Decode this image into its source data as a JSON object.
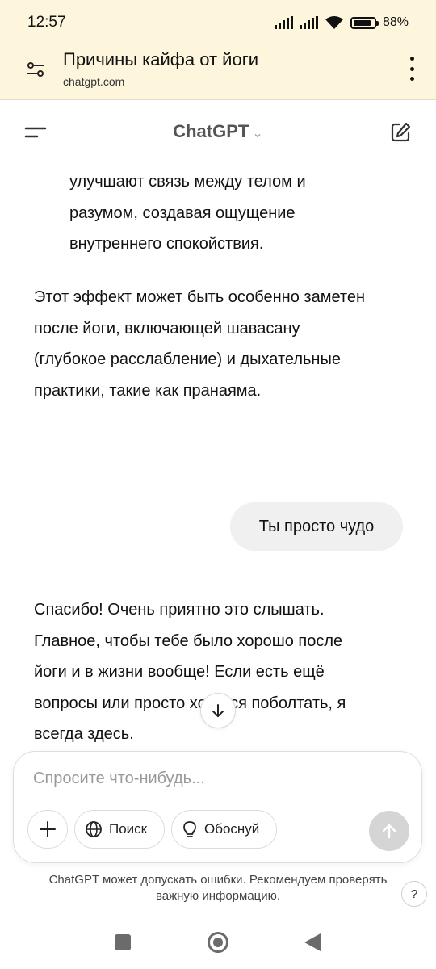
{
  "status_bar": {
    "time": "12:57",
    "battery_percent": "88%",
    "battery_level": 0.88
  },
  "browser": {
    "page_title": "Причины кайфа от йоги",
    "url": "chatgpt.com"
  },
  "app_header": {
    "brand": "ChatGPT",
    "chevron": "⌄"
  },
  "chat": {
    "assistant_partial": [
      "улучшают связь между телом и",
      "разумом, создавая ощущение",
      "внутреннего спокойствия."
    ],
    "assistant_paragraph": [
      "Этот эффект может быть особенно заметен",
      "после йоги, включающей шавасану",
      "(глубокое расслабление) и дыхательные",
      "практики, такие как пранаяма."
    ],
    "user_message": "Ты просто чудо",
    "assistant_reply": [
      "Спасибо! Очень приятно это слышать.",
      "Главное, чтобы тебе было хорошо после",
      "йоги и в жизни вообще! Если есть ещё",
      "вопросы или просто хочется поболтать, я",
      "всегда здесь."
    ]
  },
  "composer": {
    "placeholder": "Спросите что-нибудь...",
    "search_label": "Поиск",
    "reason_label": "Обоснуй"
  },
  "disclaimer": [
    "ChatGPT может допускать ошибки. Рекомендуем проверять",
    "важную информацию."
  ],
  "help_label": "?",
  "icons": [
    "tune-icon",
    "more-vert-icon",
    "hamburger-icon",
    "new-chat-icon",
    "arrow-down-icon",
    "plus-icon",
    "globe-icon",
    "lightbulb-icon",
    "arrow-up-icon",
    "help-icon"
  ]
}
